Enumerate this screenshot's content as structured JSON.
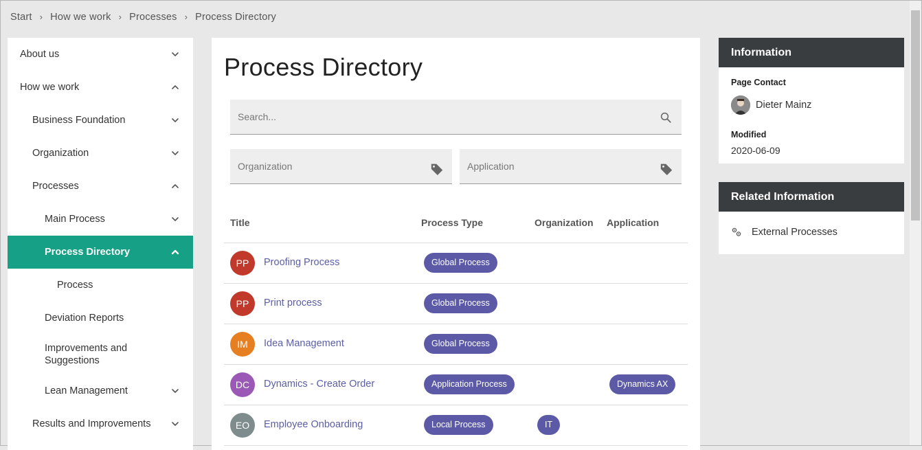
{
  "breadcrumb": [
    "Start",
    "How we work",
    "Processes",
    "Process Directory"
  ],
  "nav": {
    "items": [
      {
        "label": "About us",
        "level": 0,
        "state": "collapsed"
      },
      {
        "label": "How we work",
        "level": 0,
        "state": "expanded"
      },
      {
        "label": "Business Foundation",
        "level": 1,
        "state": "collapsed"
      },
      {
        "label": "Organization",
        "level": 1,
        "state": "collapsed"
      },
      {
        "label": "Processes",
        "level": 1,
        "state": "expanded"
      },
      {
        "label": "Main Process",
        "level": 2,
        "state": "collapsed"
      },
      {
        "label": "Process Directory",
        "level": 2,
        "state": "expanded",
        "active": true
      },
      {
        "label": "Process",
        "level": 3,
        "state": "none"
      },
      {
        "label": "Deviation Reports",
        "level": 2,
        "state": "none"
      },
      {
        "label": "Improvements and Suggestions",
        "level": 2,
        "state": "none"
      },
      {
        "label": "Lean Management",
        "level": 2,
        "state": "collapsed"
      },
      {
        "label": "Results and Improvements",
        "level": 1,
        "state": "collapsed"
      }
    ]
  },
  "main": {
    "title": "Process Directory",
    "search_placeholder": "Search...",
    "filter_org_placeholder": "Organization",
    "filter_app_placeholder": "Application",
    "columns": {
      "title": "Title",
      "type": "Process Type",
      "org": "Organization",
      "app": "Application"
    },
    "rows": [
      {
        "initials": "PP",
        "color": "#c0392b",
        "title": "Proofing Process",
        "type": "Global Process",
        "org": "",
        "app": ""
      },
      {
        "initials": "PP",
        "color": "#c0392b",
        "title": "Print process",
        "type": "Global Process",
        "org": "",
        "app": ""
      },
      {
        "initials": "IM",
        "color": "#e67e22",
        "title": "Idea Management",
        "type": "Global Process",
        "org": "",
        "app": ""
      },
      {
        "initials": "DC",
        "color": "#9b59b6",
        "title": "Dynamics - Create Order",
        "type": "Application Process",
        "org": "",
        "app": "Dynamics AX"
      },
      {
        "initials": "EO",
        "color": "#7f8c8d",
        "title": "Employee Onboarding",
        "type": "Local Process",
        "org": "IT",
        "app": ""
      }
    ]
  },
  "information": {
    "heading": "Information",
    "contact_label": "Page Contact",
    "contact_name": "Dieter Mainz",
    "modified_label": "Modified",
    "modified_value": "2020-06-09"
  },
  "related": {
    "heading": "Related Information",
    "link": "External Processes"
  },
  "colors": {
    "active_nav": "#16a085",
    "pill": "#5c5aa6",
    "link": "#5b5ea6",
    "card_header": "#3a3d40"
  }
}
